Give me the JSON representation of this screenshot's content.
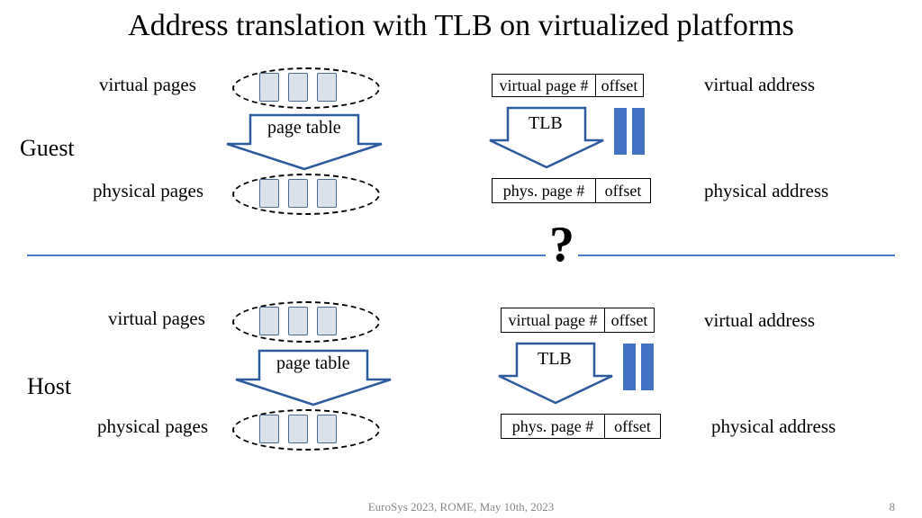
{
  "title": "Address translation with TLB on virtualized platforms",
  "guest": {
    "side_label": "Guest",
    "virtual_pages_label": "virtual pages",
    "physical_pages_label": "physical pages",
    "page_table_label": "page table",
    "tlb_label": "TLB",
    "virtual_address_label": "virtual address",
    "physical_address_label": "physical address",
    "vpn_label": "virtual page #",
    "voff_label": "offset",
    "ppn_label": "phys. page #",
    "poff_label": "offset"
  },
  "host": {
    "side_label": "Host",
    "virtual_pages_label": "virtual pages",
    "physical_pages_label": "physical pages",
    "page_table_label": "page table",
    "tlb_label": "TLB",
    "virtual_address_label": "virtual address",
    "physical_address_label": "physical address",
    "vpn_label": "virtual page #",
    "voff_label": "offset",
    "ppn_label": "phys. page #",
    "poff_label": "offset"
  },
  "question_mark": "?",
  "footer_conf": "EuroSys 2023, ROME, May 10th, 2023",
  "footer_page": "8"
}
